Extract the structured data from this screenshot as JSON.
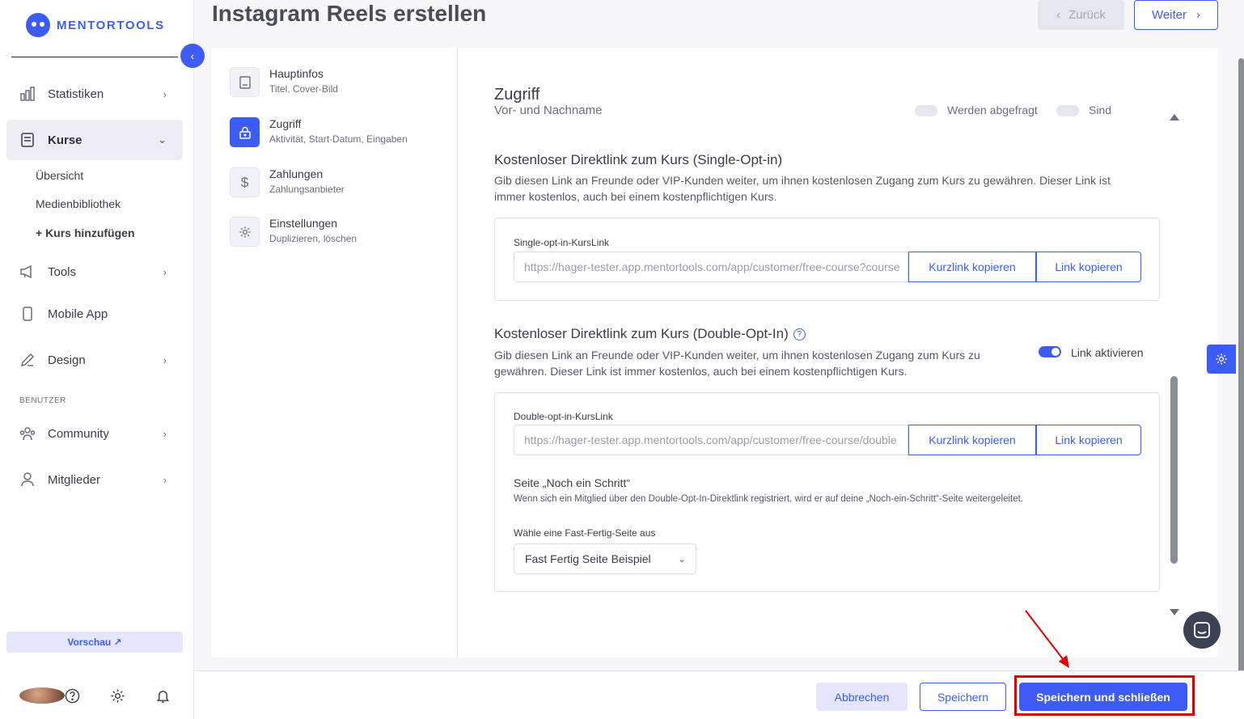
{
  "brand": {
    "name": "MENTORTOOLS",
    "accent": "#3d5cf5"
  },
  "sidebar": {
    "items": [
      {
        "label": "Statistiken",
        "icon": "bar-chart-icon"
      },
      {
        "label": "Kurse",
        "icon": "document-icon"
      },
      {
        "label": "Tools",
        "icon": "megaphone-icon"
      },
      {
        "label": "Mobile App",
        "icon": "phone-icon"
      },
      {
        "label": "Design",
        "icon": "pencil-icon"
      },
      {
        "label": "Community",
        "icon": "people-icon"
      },
      {
        "label": "Mitglieder",
        "icon": "user-icon"
      }
    ],
    "sub_items": [
      "Übersicht",
      "Medienbibliothek",
      "+ Kurs hinzufügen"
    ],
    "section_label": "BENUTZER",
    "preview": "Vorschau ↗"
  },
  "header": {
    "title": "Instagram Reels erstellen",
    "back": "Zurück",
    "next": "Weiter"
  },
  "steps": [
    {
      "title": "Hauptinfos",
      "sub": "Titel, Cover-Bild"
    },
    {
      "title": "Zugriff",
      "sub": "Aktivität, Start-Datum, Eingaben"
    },
    {
      "title": "Zahlungen",
      "sub": "Zahlungsanbieter"
    },
    {
      "title": "Einstellungen",
      "sub": "Duplizieren, löschen"
    }
  ],
  "content": {
    "section_title": "Zugriff",
    "ghost_row": {
      "label": "Vor- und Nachname",
      "opt1": "Werden abgefragt",
      "opt2": "Sind Pflichtfelder"
    },
    "single": {
      "title": "Kostenloser Direktlink zum Kurs (Single-Opt-in)",
      "desc": "Gib diesen Link an Freunde oder VIP-Kunden weiter, um ihnen kostenlosen Zugang zum Kurs zu gewähren. Dieser Link ist immer kostenlos, auch bei einem kostenpflichtigen Kurs.",
      "field_label": "Single-opt-in-KursLink",
      "url": "https://hager-tester.app.mentortools.com/app/customer/free-course?course",
      "short_btn": "Kurzlink kopieren",
      "copy_btn": "Link kopieren"
    },
    "double": {
      "title": "Kostenloser Direktlink zum Kurs (Double-Opt-In)",
      "desc": "Gib diesen Link an Freunde oder VIP-Kunden weiter, um ihnen kostenlosen Zugang zum Kurs zu gewähren. Dieser Link ist immer kostenlos, auch bei einem kostenpflichtigen Kurs.",
      "toggle_label": "Link aktivieren",
      "field_label": "Double-opt-in-KursLink",
      "url": "https://hager-tester.app.mentortools.com/app/customer/free-course/double",
      "short_btn": "Kurzlink kopieren",
      "copy_btn": "Link kopieren",
      "step_title": "Seite „Noch ein Schritt“",
      "step_desc": "Wenn sich ein Mitglied über den Double-Opt-In-Direktlink registriert, wird er auf deine „Noch-ein-Schritt“-Seite weitergeleitet.",
      "select_label": "Wähle eine Fast-Fertig-Seite aus",
      "select_value": "Fast Fertig Seite Beispiel"
    }
  },
  "footer": {
    "cancel": "Abbrechen",
    "save": "Speichern",
    "save_close": "Speichern und schließen"
  }
}
